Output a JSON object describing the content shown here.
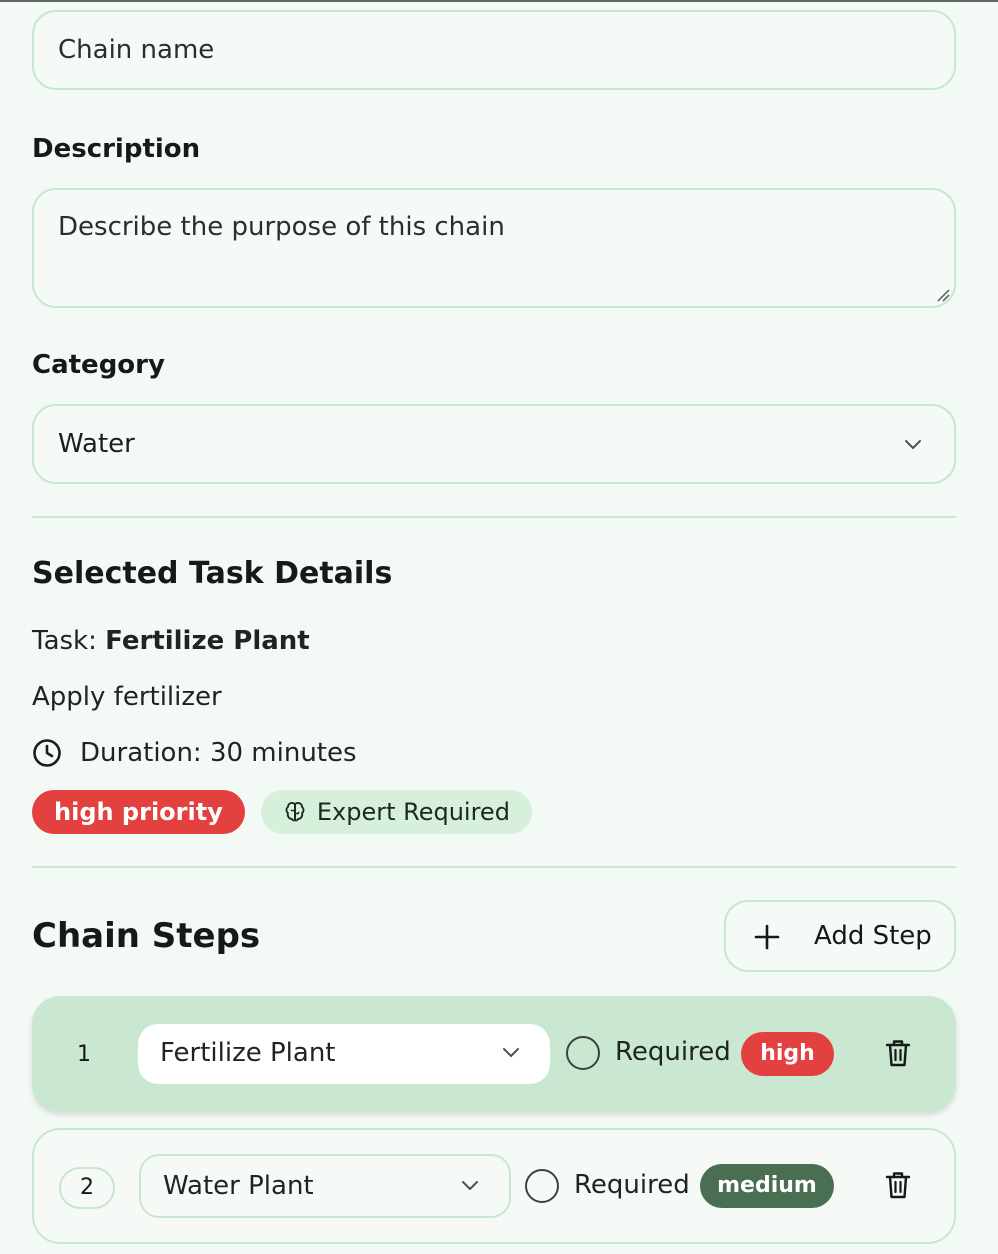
{
  "form": {
    "name_placeholder": "Chain name",
    "description_label": "Description",
    "description_placeholder": "Describe the purpose of this chain",
    "category_label": "Category",
    "category_value": "Water"
  },
  "task_details": {
    "title": "Selected Task Details",
    "task_prefix": "Task:",
    "task_name": "Fertilize Plant",
    "description": "Apply fertilizer",
    "duration": "Duration: 30 minutes",
    "priority_badge": "high priority",
    "expert_badge": "Expert Required",
    "icons": {
      "duration": "clock-icon",
      "expert": "brain-icon"
    }
  },
  "chain_steps": {
    "title": "Chain Steps",
    "add_label": "Add Step",
    "steps": [
      {
        "number": "1",
        "task": "Fertilize Plant",
        "required_label": "Required",
        "required": false,
        "priority": "high",
        "priority_color": "#e34040",
        "active": true
      },
      {
        "number": "2",
        "task": "Water Plant",
        "required_label": "Required",
        "required": false,
        "priority": "medium",
        "priority_color": "#4a6e52",
        "active": false
      }
    ]
  },
  "colors": {
    "background": "#f3f9f4",
    "border": "#c9e6cf",
    "active_step": "#c9e7d1",
    "high": "#e34040",
    "medium": "#4a6e52",
    "expert_badge": "#d6f0dc"
  }
}
